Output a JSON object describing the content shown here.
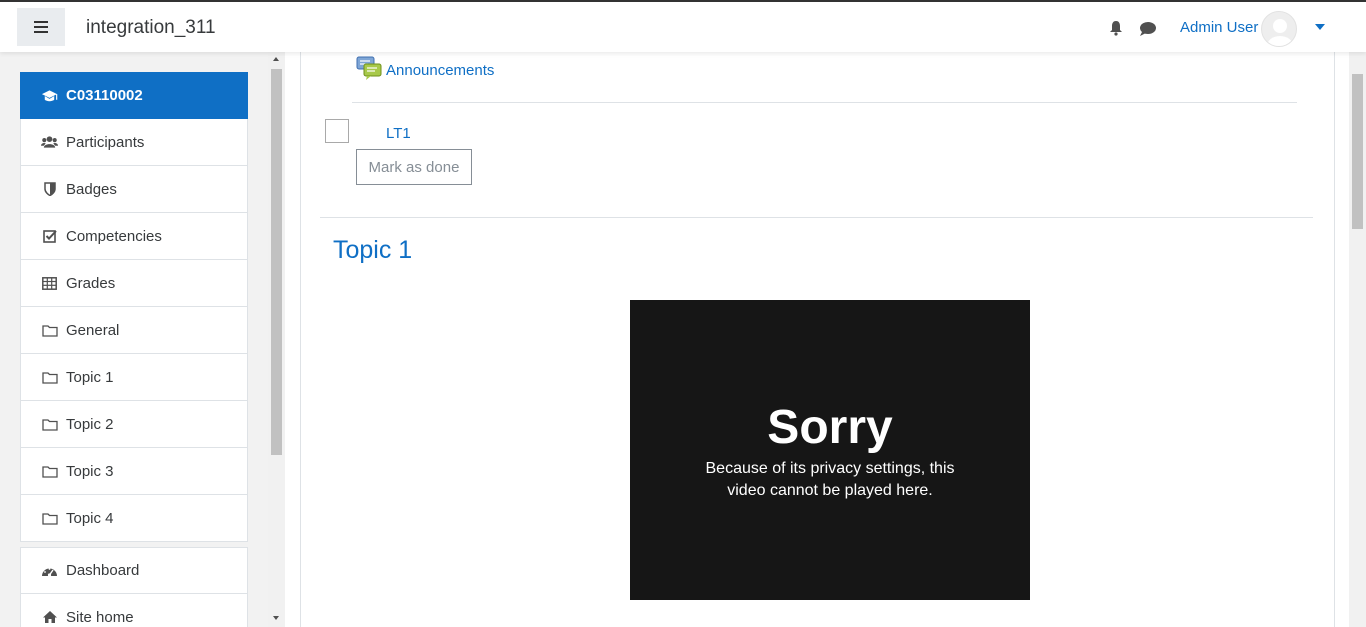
{
  "navbar": {
    "site_name": "integration_311",
    "user_name": "Admin User"
  },
  "drawer": {
    "course_item": "C03110002",
    "items": [
      {
        "label": "Participants",
        "icon": "users-icon"
      },
      {
        "label": "Badges",
        "icon": "shield-icon"
      },
      {
        "label": "Competencies",
        "icon": "check-square-icon"
      },
      {
        "label": "Grades",
        "icon": "table-icon"
      },
      {
        "label": "General",
        "icon": "folder-icon"
      },
      {
        "label": "Topic 1",
        "icon": "folder-icon"
      },
      {
        "label": "Topic 2",
        "icon": "folder-icon"
      },
      {
        "label": "Topic 3",
        "icon": "folder-icon"
      },
      {
        "label": "Topic 4",
        "icon": "folder-icon"
      }
    ],
    "items2": [
      {
        "label": "Dashboard",
        "icon": "dashboard-icon"
      },
      {
        "label": "Site home",
        "icon": "home-icon"
      }
    ]
  },
  "main": {
    "announcements_link": "Announcements",
    "activity_link": "LT1",
    "mark_done_label": "Mark as done",
    "section_title": "Topic 1",
    "video": {
      "title": "Sorry",
      "message": "Because of its privacy settings, this video cannot be played here."
    }
  },
  "colors": {
    "brand": "#0f6fc5",
    "video_bg": "#161616"
  }
}
